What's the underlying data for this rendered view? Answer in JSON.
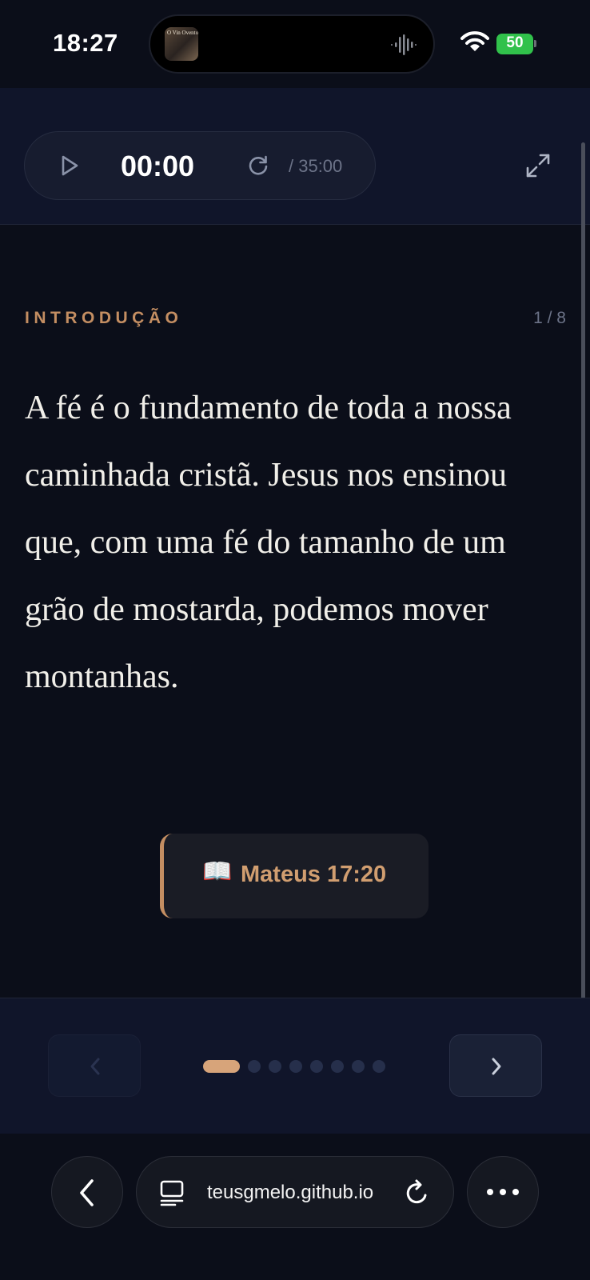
{
  "status_bar": {
    "time": "18:27",
    "now_playing_art_text": "O Vin Ovento",
    "battery": "50",
    "battery_color": "#31c14b"
  },
  "player": {
    "elapsed": "00:00",
    "duration": "/ 35:00",
    "icons": [
      "play-icon",
      "replay-icon",
      "expand-icon"
    ]
  },
  "content": {
    "section_label": "INTRODUÇÃO",
    "page_counter": "1 / 8",
    "body": "A fé é o fundamento de toda a nossa caminhada cristã. Jesus nos ensinou que, com uma fé do tamanho de um grão de mostarda, podemos mover montanhas.",
    "reference_icon": "📖",
    "reference": "Mateus 17:20",
    "accent_color": "#c48e62"
  },
  "pagination": {
    "total": 8,
    "current": 1
  },
  "browser": {
    "url": "teusgmelo.github.io",
    "icons": [
      "back-icon",
      "tabs-icon",
      "reload-icon",
      "more-icon"
    ]
  }
}
